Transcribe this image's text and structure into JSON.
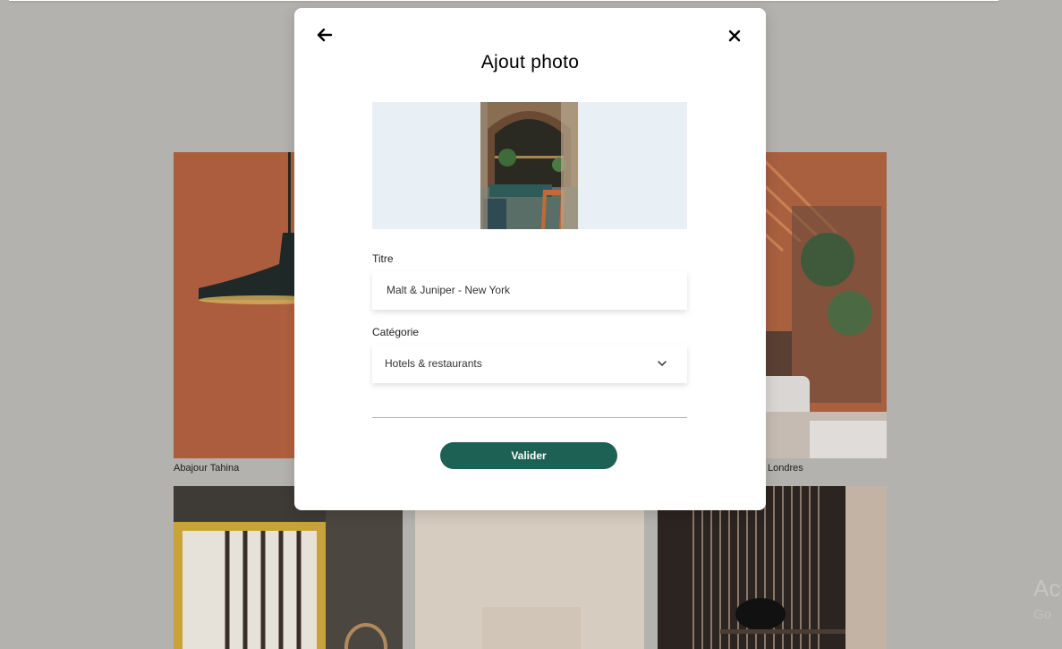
{
  "modal": {
    "title": "Ajout photo",
    "back_icon": "arrow-left-icon",
    "close_icon": "close-icon",
    "title_field": {
      "label": "Titre",
      "value": "Malt & Juniper - New York"
    },
    "category_field": {
      "label": "Catégorie",
      "selected": "Hotels & restaurants",
      "icon": "chevron-down-icon"
    },
    "submit_label": "Valider",
    "accent_color": "#1d6154",
    "preview_bg": "#e8f0f6"
  },
  "gallery": {
    "items": [
      {
        "caption": "Abajour Tahina"
      },
      {
        "caption": "Londres"
      }
    ]
  },
  "watermark": {
    "line1": "Ac",
    "line2": "Go"
  }
}
